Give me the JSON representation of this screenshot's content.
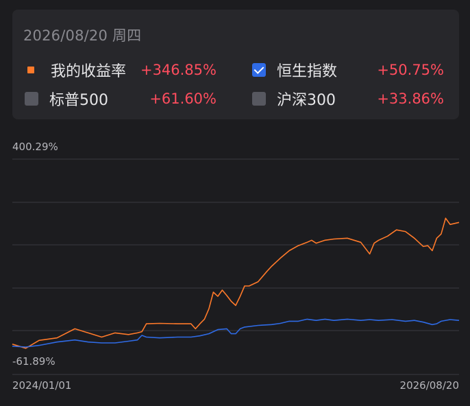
{
  "legend": {
    "date": "2026/08/20 周四",
    "items": [
      {
        "label": "我的收益率",
        "value": "+346.85%",
        "marker": "orange-square",
        "checked": null
      },
      {
        "label": "恒生指数",
        "value": "+50.75%",
        "marker": "checkbox",
        "checked": true
      },
      {
        "label": "标普500",
        "value": "+61.60%",
        "marker": "checkbox",
        "checked": false
      },
      {
        "label": "沪深300",
        "value": "+33.86%",
        "marker": "checkbox",
        "checked": false
      }
    ]
  },
  "colors": {
    "background": "#1c1c1f",
    "card": "#27272b",
    "orange": "#ff7a2a",
    "blue": "#2f6be6",
    "positive": "#ff4d5e",
    "grid": "#3a3a40",
    "axis_text": "#b7b7bc"
  },
  "chart_data": {
    "type": "line",
    "x_start_label": "2024/01/01",
    "x_end_label": "2026/08/20",
    "y_max_label": "400.29%",
    "y_min_label": "-61.89%",
    "ylim": [
      -61.89,
      400.29
    ],
    "grid": true,
    "series": [
      {
        "name": "我的收益率",
        "color": "#ff7a2a",
        "x": [
          0,
          0.03,
          0.06,
          0.1,
          0.14,
          0.17,
          0.2,
          0.23,
          0.26,
          0.28,
          0.29,
          0.3,
          0.33,
          0.37,
          0.4,
          0.41,
          0.42,
          0.43,
          0.44,
          0.45,
          0.46,
          0.47,
          0.48,
          0.49,
          0.5,
          0.51,
          0.52,
          0.53,
          0.55,
          0.57,
          0.58,
          0.6,
          0.62,
          0.64,
          0.66,
          0.67,
          0.68,
          0.7,
          0.72,
          0.75,
          0.78,
          0.8,
          0.81,
          0.82,
          0.84,
          0.86,
          0.88,
          0.9,
          0.92,
          0.93,
          0.94,
          0.95,
          0.96,
          0.97,
          0.98,
          1.0
        ],
        "y": [
          -45,
          -55,
          -36,
          -30,
          -8,
          -18,
          -28,
          -18,
          -22,
          -18,
          -15,
          4,
          5,
          4,
          4,
          -8,
          4,
          15,
          40,
          80,
          70,
          85,
          72,
          58,
          48,
          70,
          95,
          95,
          105,
          130,
          142,
          162,
          180,
          192,
          200,
          205,
          198,
          205,
          208,
          210,
          200,
          172,
          198,
          205,
          215,
          230,
          226,
          210,
          190,
          192,
          180,
          210,
          220,
          258,
          243,
          248
        ]
      },
      {
        "name": "恒生指数",
        "color": "#2f6be6",
        "x": [
          0,
          0.03,
          0.06,
          0.1,
          0.14,
          0.17,
          0.2,
          0.23,
          0.26,
          0.28,
          0.29,
          0.3,
          0.33,
          0.37,
          0.4,
          0.42,
          0.44,
          0.46,
          0.48,
          0.49,
          0.5,
          0.51,
          0.52,
          0.55,
          0.58,
          0.6,
          0.62,
          0.64,
          0.66,
          0.68,
          0.7,
          0.72,
          0.75,
          0.78,
          0.8,
          0.82,
          0.85,
          0.88,
          0.9,
          0.92,
          0.94,
          0.95,
          0.96,
          0.98,
          1.0
        ],
        "y": [
          -50,
          -52,
          -48,
          -40,
          -35,
          -40,
          -42,
          -42,
          -38,
          -35,
          -24,
          -28,
          -30,
          -28,
          -28,
          -25,
          -20,
          -10,
          -8,
          -20,
          -20,
          -8,
          -4,
          0,
          2,
          5,
          10,
          10,
          15,
          12,
          15,
          12,
          15,
          12,
          14,
          12,
          14,
          10,
          12,
          8,
          2,
          4,
          10,
          14,
          12
        ]
      }
    ]
  }
}
